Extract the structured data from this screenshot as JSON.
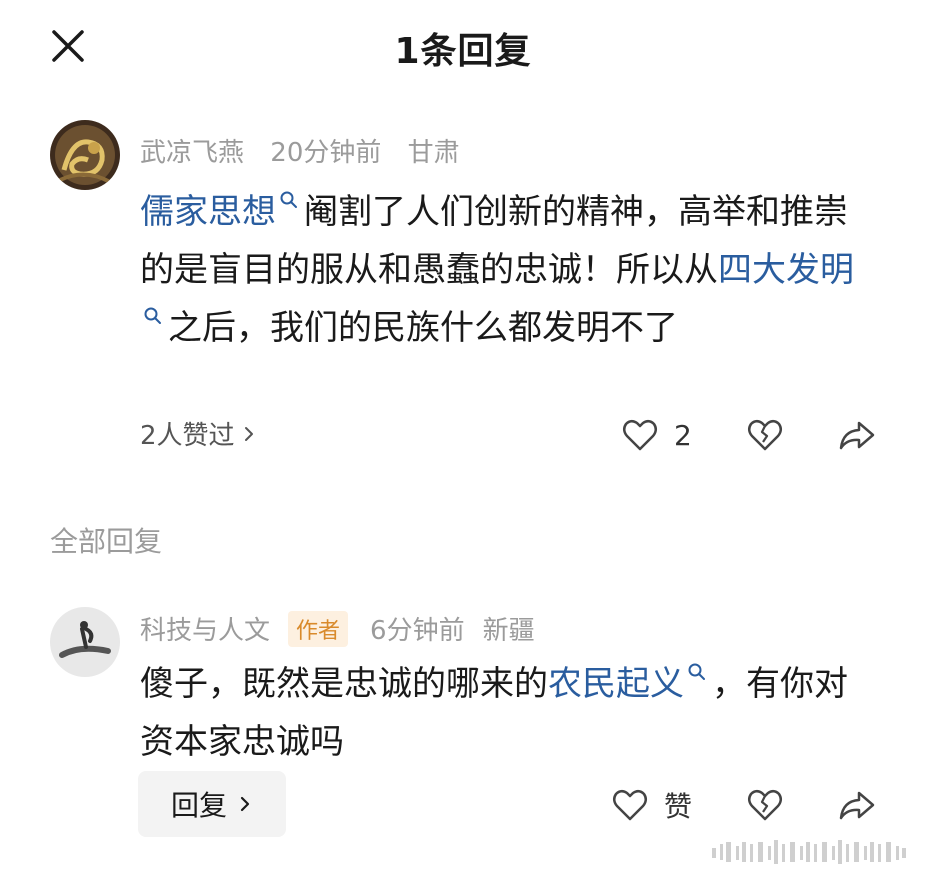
{
  "header": {
    "title": "1条回复"
  },
  "comment": {
    "username": "武凉飞燕",
    "time": "20分钟前",
    "location": "甘肃",
    "text_parts": [
      {
        "text": "儒家思想",
        "link": true
      },
      {
        "text": "阉割了人们创新的精神，高举和推崇的是盲目的服从和愚蠢的忠诚！所以从",
        "link": false
      },
      {
        "text": "四大发明",
        "link": true
      },
      {
        "text": "之后，我们的民族什么都发明不了",
        "link": false
      }
    ],
    "likes_summary": "2人赞过",
    "like_count": "2"
  },
  "section_label": "全部回复",
  "reply": {
    "username": "科技与人文",
    "badge": "作者",
    "time": "6分钟前",
    "location": "新疆",
    "text_parts": [
      {
        "text": "傻子，既然是忠诚的哪来的",
        "link": false
      },
      {
        "text": "农民起义",
        "link": true
      },
      {
        "text": "，有你对资本家忠诚吗",
        "link": false
      }
    ],
    "reply_button": "回复",
    "like_label": "赞"
  },
  "icons": {
    "close": "close-icon",
    "like": "heart-icon",
    "dislike": "broken-heart-icon",
    "share": "share-arrow-icon",
    "search_link": "search-icon",
    "chevron": "chevron-right-icon"
  },
  "colors": {
    "link": "#2a5d9f",
    "meta": "#9b9b9b",
    "badge_text": "#d98a2b",
    "badge_bg": "#fdf0e0"
  }
}
